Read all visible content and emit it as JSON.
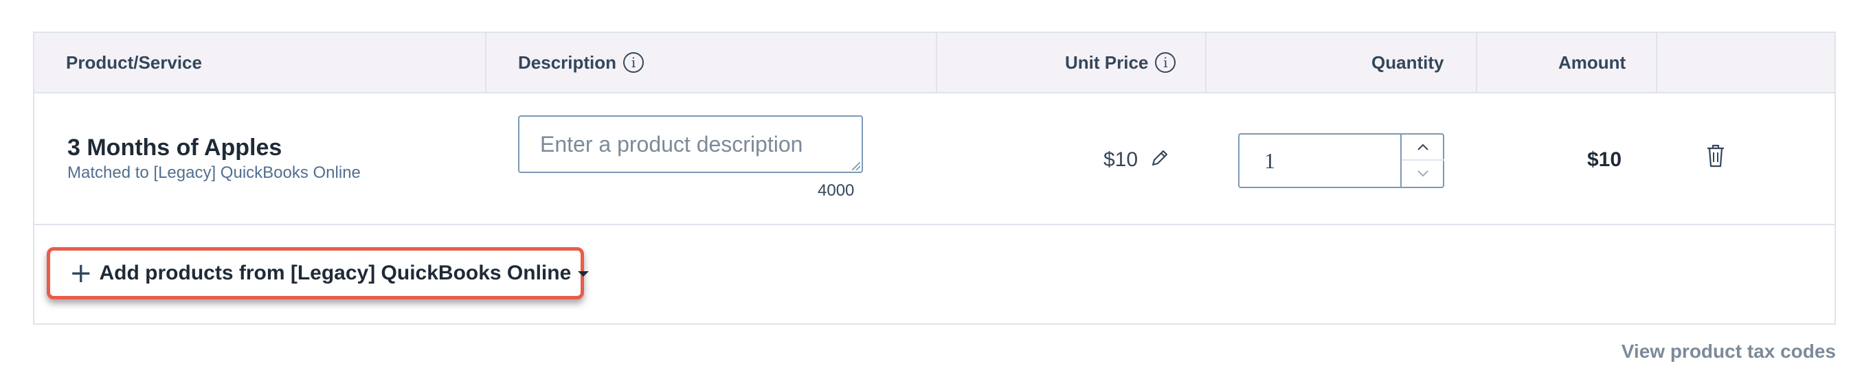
{
  "table": {
    "headers": {
      "product": "Product/Service",
      "description": "Description",
      "unit_price": "Unit Price",
      "quantity": "Quantity",
      "amount": "Amount"
    },
    "info_glyph": "i",
    "row": {
      "product_name": "3 Months of Apples",
      "product_sub": "Matched to [Legacy] QuickBooks Online",
      "description_placeholder": "Enter a product description",
      "description_value": "",
      "char_count": "4000",
      "unit_price": "$10",
      "quantity": "1",
      "amount": "$10"
    }
  },
  "add_button": {
    "plus": "+",
    "label": "Add products from [Legacy] QuickBooks Online",
    "highlight_color": "#e85c4a"
  },
  "footer": {
    "tax_link": "View product tax codes"
  },
  "icons": {
    "info": "info-circle-icon",
    "edit": "pencil-icon",
    "delete": "trash-icon",
    "up": "chevron-up-icon",
    "down": "chevron-down-icon",
    "caret": "caret-down-icon"
  }
}
